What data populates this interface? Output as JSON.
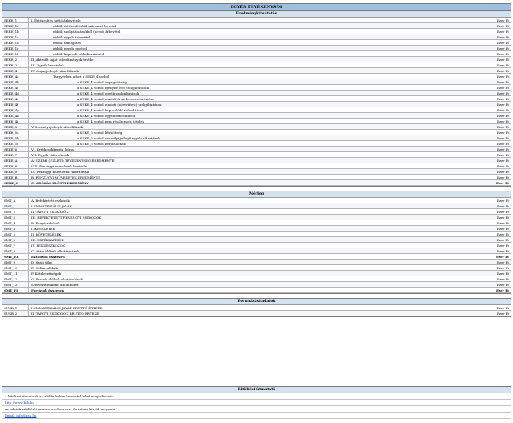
{
  "sections": [
    {
      "title": "EGYÉB TEVÉKENYSÉG",
      "subtitle": "Eredménykimutatás",
      "rows": [
        {
          "code": "SEKE_1",
          "indent": 0,
          "bold": false,
          "text": "I. Értékesítés nettó árbevétele",
          "value": "Ezer Ft"
        },
        {
          "code": "SEKE_1a",
          "indent": 1,
          "bold": false,
          "text": "ebből: értékesítésből származó bevétel",
          "value": "Ezer Ft"
        },
        {
          "code": "SEKE_1b",
          "indent": 1,
          "bold": false,
          "text": "ebből: szolgáltatásokból (nettó) árbevétel",
          "value": "Ezer Ft"
        },
        {
          "code": "SEKE_1c",
          "indent": 1,
          "bold": false,
          "text": "ebből: egyéb árbevétel",
          "value": "Ezer Ft"
        },
        {
          "code": "SEKE_1d",
          "indent": 1,
          "bold": false,
          "text": "ebből: támogatás",
          "value": "Ezer Ft"
        },
        {
          "code": "SEKE_1e",
          "indent": 1,
          "bold": false,
          "text": "ebből: egyéb bevétel",
          "value": "Ezer Ft"
        },
        {
          "code": "SEKE_1f",
          "indent": 1,
          "bold": false,
          "text": "ebből: kapcsolt vállalkozásoktól",
          "value": "Ezer Ft"
        },
        {
          "code": "SEKE_2",
          "indent": 0,
          "bold": false,
          "text": "II. Aktivált saját teljesítmények értéke",
          "value": "Ezer Ft"
        },
        {
          "code": "SEKE_3",
          "indent": 0,
          "bold": false,
          "text": "III. Egyéb bevételek",
          "value": "Ezer Ft"
        },
        {
          "code": "SEKE_4",
          "indent": 0,
          "bold": false,
          "text": "IV. Anyagjellegű ráfordítások",
          "value": "Ezer Ft"
        },
        {
          "code": "SEKE_4a",
          "indent": 1,
          "bold": false,
          "text": "Tárgyévben adott a SEKE_4 sorból",
          "value": "Ezer Ft"
        },
        {
          "code": "SEKE_4b",
          "indent": 2,
          "bold": false,
          "text": "a SEKE_4 sorból anyagköltség",
          "value": "Ezer Ft"
        },
        {
          "code": "SEKE_4c",
          "indent": 2,
          "bold": false,
          "text": "a SEKE_4 sorból igénybe vett szolgáltatások",
          "value": "Ezer Ft"
        },
        {
          "code": "SEKE_4d",
          "indent": 2,
          "bold": false,
          "text": "a SEKE_4 sorból egyéb szolgáltatások",
          "value": "Ezer Ft"
        },
        {
          "code": "SEKE_4e",
          "indent": 2,
          "bold": false,
          "text": "a SEKE_4 sorból eladott áruk beszerzési értéke",
          "value": "Ezer Ft"
        },
        {
          "code": "SEKE_4f",
          "indent": 2,
          "bold": false,
          "text": "a SEKE_4 sorból eladott (közvetített) szolgáltatások",
          "value": "Ezer Ft"
        },
        {
          "code": "SEKE_4g",
          "indent": 2,
          "bold": false,
          "text": "a SEKE_4 sorból kapcsolódó ráfordítások",
          "value": "Ezer Ft"
        },
        {
          "code": "SEKE_4h",
          "indent": 2,
          "bold": false,
          "text": "a SEKE_4 sorból egyéb ráfordítások",
          "value": "Ezer Ft"
        },
        {
          "code": "SEKE_4i",
          "indent": 2,
          "bold": false,
          "text": "a SEKE_4 sorból nem részletezett tételek",
          "value": "Ezer Ft"
        },
        {
          "code": "SEKE_5",
          "indent": 0,
          "bold": false,
          "text": "V. Személyi jellegű ráfordítások",
          "value": "Ezer Ft"
        },
        {
          "code": "SEKE_5a",
          "indent": 2,
          "bold": false,
          "text": "a SEKE_5 sorból bérköltség",
          "value": "Ezer Ft"
        },
        {
          "code": "SEKE_5b",
          "indent": 2,
          "bold": false,
          "text": "a SEKE_5 sorból személyi jellegű egyéb kifizetések",
          "value": "Ezer Ft"
        },
        {
          "code": "SEKE_5c",
          "indent": 2,
          "bold": false,
          "text": "a SEKE_5 sorból bérjárulékok",
          "value": "Ezer Ft"
        },
        {
          "code": "SEKE_6",
          "indent": 0,
          "bold": false,
          "text": "VI. Értékcsökkenési leírás",
          "value": "Ezer Ft"
        },
        {
          "code": "SEKE_7",
          "indent": 0,
          "bold": false,
          "text": "VII. Egyéb ráfordítások",
          "value": "Ezer Ft"
        },
        {
          "code": "SEKE_A",
          "indent": 0,
          "bold": false,
          "text": "A. ÜZEMI (ÜZLETI) TEVÉKENYSÉG EREDMÉNYE",
          "value": "Ezer Ft"
        },
        {
          "code": "SEKE_8",
          "indent": 0,
          "bold": false,
          "text": "VIII. Pénzügyi műveletek bevételei",
          "value": "Ezer Ft"
        },
        {
          "code": "SEKE_9",
          "indent": 0,
          "bold": false,
          "text": "IX. Pénzügyi műveletek ráfordításai",
          "value": "Ezer Ft"
        },
        {
          "code": "SEKE_B",
          "indent": 0,
          "bold": false,
          "text": "B. PÉNZÜGYI MŰVELETEK EREDMÉNYE",
          "value": "Ezer Ft"
        },
        {
          "code": "SEKE_C",
          "indent": 0,
          "bold": true,
          "text": "C. ADÓZÁS ELŐTTI EREDMÉNY",
          "value": "Ezer Ft"
        }
      ]
    },
    {
      "title": "",
      "subtitle": "Mérleg",
      "rows": [
        {
          "code": "SMT_A",
          "indent": 0,
          "bold": false,
          "text": "A. Befektetett eszközök",
          "value": "Ezer Ft"
        },
        {
          "code": "SMT_1",
          "indent": 0,
          "bold": false,
          "text": "I. IMMATERIÁLIS JAVAK",
          "value": "Ezer Ft"
        },
        {
          "code": "SMT_2",
          "indent": 0,
          "bold": false,
          "text": "II. TÁRGYI ESZKÖZÖK",
          "value": "Ezer Ft"
        },
        {
          "code": "SMT_3",
          "indent": 0,
          "bold": false,
          "text": "III. BEFEKTETETT PÉNZÜGYI ESZKÖZÖK",
          "value": "Ezer Ft"
        },
        {
          "code": "SMT_B",
          "indent": 0,
          "bold": false,
          "text": "B. Forgóeszközök",
          "value": "Ezer Ft"
        },
        {
          "code": "SMT_4",
          "indent": 0,
          "bold": false,
          "text": "I. KÉSZLETEK",
          "value": "Ezer Ft"
        },
        {
          "code": "SMT_5",
          "indent": 0,
          "bold": false,
          "text": "II. KÖVETELÉSEK",
          "value": "Ezer Ft"
        },
        {
          "code": "SMT_6",
          "indent": 0,
          "bold": false,
          "text": "III. ÉRTÉKPAPÍROK",
          "value": "Ezer Ft"
        },
        {
          "code": "SMT_7",
          "indent": 0,
          "bold": false,
          "text": "IV. PÉNZESZKÖZÖK",
          "value": "Ezer Ft"
        },
        {
          "code": "SMT_8",
          "indent": 0,
          "bold": false,
          "text": "C. Aktív időbeli elhatárolások",
          "value": "Ezer Ft"
        },
        {
          "code": "SMT_EE",
          "indent": 0,
          "bold": true,
          "text": "Eszközök összesen",
          "value": "Ezer Ft"
        },
        {
          "code": "SMT_9",
          "indent": 0,
          "bold": false,
          "text": "D. Saját tőke",
          "value": "Ezer Ft"
        },
        {
          "code": "SMT_10",
          "indent": 0,
          "bold": false,
          "text": "E. Céltartalékok",
          "value": "Ezer Ft"
        },
        {
          "code": "SMT_11",
          "indent": 0,
          "bold": false,
          "text": "F. Kötelezettségek",
          "value": "Ezer Ft"
        },
        {
          "code": "SMT_12",
          "indent": 0,
          "bold": false,
          "text": "G. Passzív időbeli elhatárolások",
          "value": "Ezer Ft"
        },
        {
          "code": "SMT_13",
          "indent": 0,
          "bold": false,
          "text": "Szervezetenkénti különbözet",
          "value": "Ezer Ft"
        },
        {
          "code": "SMT_FF",
          "indent": 0,
          "bold": true,
          "text": "Források összesen",
          "value": "Ezer Ft"
        }
      ]
    },
    {
      "title": "",
      "subtitle": "Beruházási adatok",
      "rows": [
        {
          "code": "SUSB_1",
          "indent": 0,
          "bold": false,
          "text": "I. IMMATERIÁLIS JAVAK BRUTTÓ ÉRTÉKE",
          "value": "Ezer Ft"
        },
        {
          "code": "SUSB_2",
          "indent": 0,
          "bold": false,
          "text": "II. TÁRGYI ESZKÖZÖK BRUTTÓ ÉRTÉKE",
          "value": "Ezer Ft"
        }
      ]
    }
  ],
  "notes": {
    "title": "Kitöltési útmutató",
    "lines": [
      "A kitöltési útmutatót az alábbi linken keresztül lehet megtekinteni:",
      "http://www.ksh.hu",
      "Az adatok kitöltését minden esetben ezer forintban kérjük megadni.",
      "Email: info@ksh.hu"
    ]
  }
}
